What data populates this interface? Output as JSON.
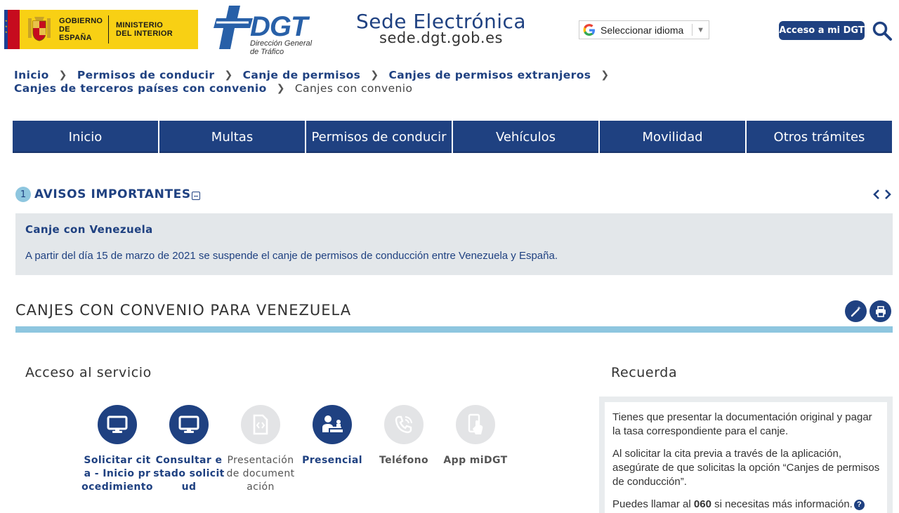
{
  "header": {
    "gobierno_text": "GOBIERNO\nDE ESPAÑA",
    "ministerio_text": "MINISTERIO\nDEL INTERIOR",
    "dgt_word": "DGT",
    "dgt_subtitle": "Dirección General\nde Tráfico",
    "sede_title": "Sede Electrónica",
    "sede_url": "sede.dgt.gob.es",
    "language_select": "Seleccionar idioma",
    "acceso_button": "Acceso a mi DGT",
    "icons": {
      "search": "search-icon",
      "google": "google-icon",
      "language_caret": "caret-down-icon"
    }
  },
  "breadcrumb": {
    "items": [
      "Inicio",
      "Permisos de conducir",
      "Canje de permisos",
      "Canjes de permisos extranjeros",
      "Canjes de terceros países con convenio"
    ],
    "current": "Canjes con convenio"
  },
  "nav": {
    "items": [
      "Inicio",
      "Multas",
      "Permisos de conducir",
      "Vehículos",
      "Movilidad",
      "Otros trámites"
    ]
  },
  "avisos": {
    "count": "1",
    "title": "AVISOS IMPORTANTES",
    "notice_title": "Canje con Venezuela",
    "notice_text": "A partir del día 15 de marzo de 2021 se suspende el canje de permisos de conducción entre Venezuela y España."
  },
  "section": {
    "title": "CANJES CON CONVENIO PARA VENEZUELA"
  },
  "acceso": {
    "title": "Acceso al servicio",
    "services": [
      {
        "label": "Solicitar cita - Inicio procedimiento",
        "icon": "monitor-icon",
        "enabled": true
      },
      {
        "label": "Consultar estado solicitud",
        "icon": "monitor-icon",
        "enabled": true
      },
      {
        "label": "Presentación de documentación",
        "icon": "document-icon",
        "enabled": false
      },
      {
        "label": "Presencial",
        "icon": "person-desk-icon",
        "enabled": true
      },
      {
        "label": "Teléfono",
        "icon": "phone-icon",
        "enabled": false
      },
      {
        "label": "App miDGT",
        "icon": "mobile-app-icon",
        "enabled": false
      }
    ]
  },
  "recuerda": {
    "title": "Recuerda",
    "p1": "Tienes que presentar la documentación original y pagar la tasa correspondiente para el canje.",
    "p2": "Al solicitar la cita previa a través de la aplicación, asegúrate de que solicitas la opción “Canjes de permisos de conducción”.",
    "p3_before": "Puedes llamar al ",
    "p3_number": "060",
    "p3_after": " si necesitas más información.",
    "help_glyph": "?"
  },
  "colors": {
    "primary": "#1f4181",
    "accent": "#8ec6df",
    "notice_bg": "#e3e7ea",
    "gob_yellow": "#f8d014"
  }
}
